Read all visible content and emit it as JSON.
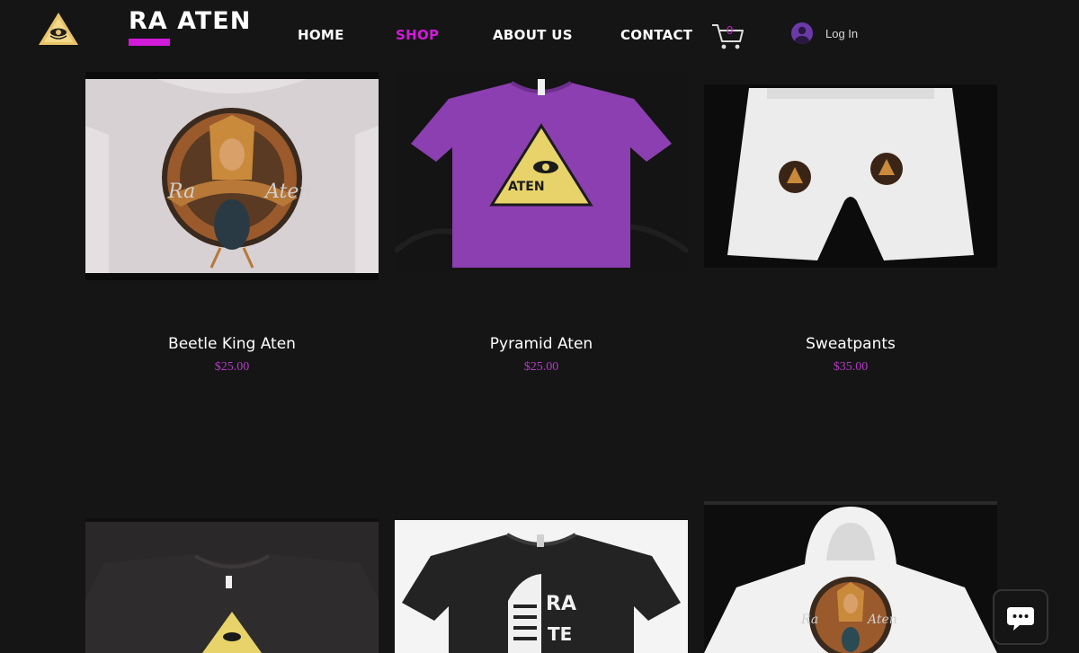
{
  "brand": {
    "title": "RA ATEN",
    "accent": "#d21ad9"
  },
  "nav": {
    "items": [
      {
        "label": "HOME",
        "active": false
      },
      {
        "label": "SHOP",
        "active": true
      },
      {
        "label": "ABOUT US",
        "active": false
      },
      {
        "label": "CONTACT",
        "active": false
      }
    ]
  },
  "cart": {
    "count": "0",
    "icon": "cart-icon"
  },
  "account": {
    "login_label": "Log In",
    "icon": "avatar-icon"
  },
  "products": [
    {
      "name": "Beetle King Aten",
      "price": "$25.00",
      "image": "beetle-king-shirt-image"
    },
    {
      "name": "Pyramid Aten",
      "price": "$25.00",
      "image": "purple-pyramid-shirt-image"
    },
    {
      "name": "Sweatpants",
      "price": "$35.00",
      "image": "white-sweatpants-image"
    },
    {
      "name": "",
      "price": "",
      "image": "black-pyramid-shirt-image"
    },
    {
      "name": "",
      "price": "",
      "image": "black-pharaoh-shirt-image"
    },
    {
      "name": "",
      "price": "",
      "image": "white-hoodie-image"
    }
  ],
  "chat": {
    "icon": "chat-bubble-icon"
  },
  "colors": {
    "background": "#151516",
    "price": "#b13cc2",
    "purple_shirt": "#8b3fb0"
  }
}
